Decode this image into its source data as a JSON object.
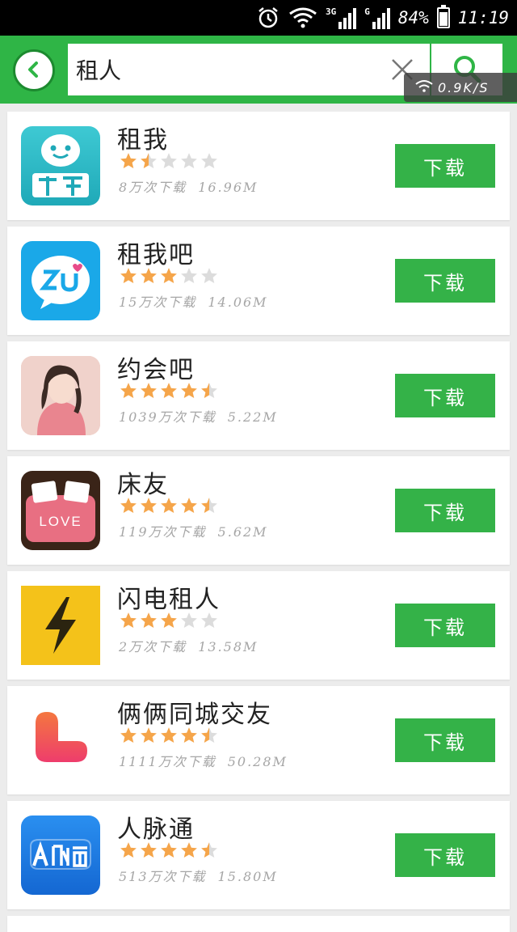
{
  "status_bar": {
    "net3g": "3G",
    "net2g": "G",
    "battery": "84%",
    "time": "11:19",
    "battery_level": 0.84
  },
  "header": {
    "search_value": "租人",
    "net_speed": "0.9K/S"
  },
  "colors": {
    "header_green": "#2fb546",
    "button_green": "#34b248",
    "star_on": "#f5a54a",
    "star_off": "#dcdcdc"
  },
  "apps": [
    {
      "name": "租我",
      "rating": 1.5,
      "downloads": "8万次下载",
      "size": "16.96M",
      "button": "下载",
      "icon": "zuwo-app-icon"
    },
    {
      "name": "租我吧",
      "rating": 3,
      "downloads": "15万次下载",
      "size": "14.06M",
      "button": "下载",
      "icon": "zuwoba-app-icon"
    },
    {
      "name": "约会吧",
      "rating": 4.5,
      "downloads": "1039万次下载",
      "size": "5.22M",
      "button": "下载",
      "icon": "yuehuiba-app-icon"
    },
    {
      "name": "床友",
      "rating": 4.5,
      "downloads": "119万次下载",
      "size": "5.62M",
      "button": "下载",
      "icon": "chuangyou-app-icon"
    },
    {
      "name": "闪电租人",
      "rating": 3,
      "downloads": "2万次下载",
      "size": "13.58M",
      "button": "下载",
      "icon": "lightning-app-icon"
    },
    {
      "name": "俩俩同城交友",
      "rating": 4.5,
      "downloads": "1111万次下载",
      "size": "50.28M",
      "button": "下载",
      "icon": "liangliang-app-icon"
    },
    {
      "name": "人脉通",
      "rating": 4.5,
      "downloads": "513万次下载",
      "size": "15.80M",
      "button": "下载",
      "icon": "renmaitong-app-icon"
    }
  ]
}
